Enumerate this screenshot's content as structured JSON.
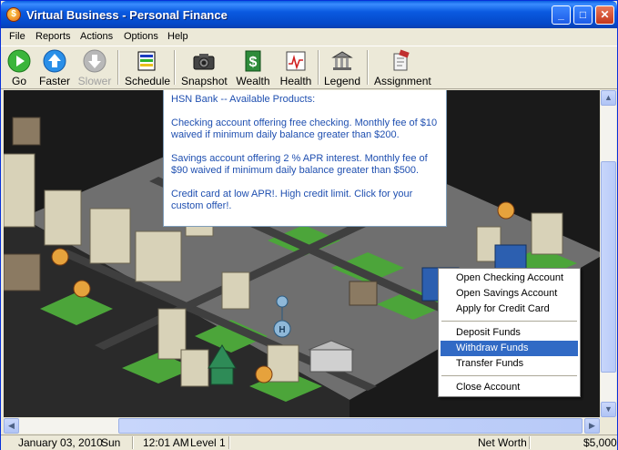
{
  "window": {
    "title": "Virtual Business - Personal Finance",
    "app_icon_glyph": "$"
  },
  "menu": [
    "File",
    "Reports",
    "Actions",
    "Options",
    "Help"
  ],
  "toolbar": {
    "go": "Go",
    "faster": "Faster",
    "slower": "Slower",
    "schedule": "Schedule",
    "snapshot": "Snapshot",
    "wealth": "Wealth",
    "health": "Health",
    "legend": "Legend",
    "assignment": "Assignment"
  },
  "info_popup": {
    "heading": "HSN Bank -- Available Products:",
    "checking": "Checking account offering free checking. Monthly fee of $10 waived if minimum daily balance greater than $200.",
    "savings": "Savings account offering 2 % APR interest. Monthly fee of $90 waived if minimum daily balance greater than $500.",
    "credit": "Credit card at low APR!. High credit limit. Click for your custom offer!."
  },
  "context_menu": {
    "items": [
      "Open Checking Account",
      "Open Savings Account",
      "Apply for Credit Card",
      "Deposit Funds",
      "Withdraw Funds",
      "Transfer Funds",
      "Close Account"
    ],
    "selected": "Withdraw Funds"
  },
  "status": {
    "date": "January 03, 2010",
    "day": "Sun",
    "time": "12:01 AM",
    "level": "Level 1",
    "net_worth_label": "Net Worth",
    "net_worth": "$5,000"
  },
  "colors": {
    "title_blue": "#0a5ae0",
    "selection": "#316ac5",
    "info_text": "#1f4fb0"
  }
}
